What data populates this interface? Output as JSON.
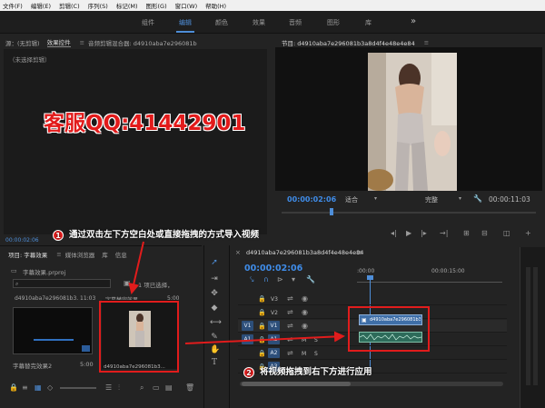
{
  "menu": [
    "文件(F)",
    "编辑(E)",
    "剪辑(C)",
    "序列(S)",
    "标记(M)",
    "图形(G)",
    "窗口(W)",
    "帮助(H)"
  ],
  "workspaces": [
    "组件",
    "编辑",
    "颜色",
    "效果",
    "音频",
    "图形",
    "库"
  ],
  "workspace_more": "»",
  "source_panel": {
    "tabs": [
      "源：(无剪辑)",
      "效果控件",
      "音频剪辑混合器: d4910aba7e296081b3a8d4f4e48e4e84"
    ],
    "no_clip": "（未选择剪辑）",
    "timecode": "00:00:02:06"
  },
  "overlay": "客服QQ:41442901",
  "program_monitor": {
    "title": "节目: d4910aba7e296081b3a8d4f4e48e4e84",
    "timecode": "00:00:02:06",
    "fit": "适合",
    "quality": "完整",
    "duration": "00:00:11:03"
  },
  "project_panel": {
    "tabs": [
      "项目: 字幕效果",
      "媒体浏览器",
      "库",
      "信息"
    ],
    "project_file": "字幕效果.prproj",
    "selection": "1 项已选择，",
    "items": [
      {
        "name": "字幕替完效果2",
        "duration": "5:00",
        "header": "d4910aba7e296081b3...",
        "header_dur": "11:03"
      },
      {
        "name": "d4910aba7e296081b3...",
        "duration": "",
        "header": "字幕替完效果",
        "header_dur": "5:00"
      }
    ]
  },
  "timeline": {
    "title": "d4910aba7e296081b3a8d4f4e48e4e84",
    "timecode": "00:00:02:06",
    "ruler": [
      ":00:00",
      "00:00:15:00"
    ],
    "tracks": [
      "V3",
      "V2",
      "V1",
      "A1",
      "A2",
      "A3"
    ],
    "src_v": "V1",
    "src_a": "A1",
    "clip_label": "d4910aba7e296081b3a8d4f4e48e4e84"
  },
  "callouts": [
    {
      "num": "1",
      "text": "通过双击左下方空白处或直接拖拽的方式导入视频"
    },
    {
      "num": "2",
      "text": "将视频拖拽到右下方进行应用"
    }
  ],
  "colors": {
    "accent": "#4e8ed8",
    "annotation": "#e11c1c",
    "timecode": "#3f8ce8"
  }
}
